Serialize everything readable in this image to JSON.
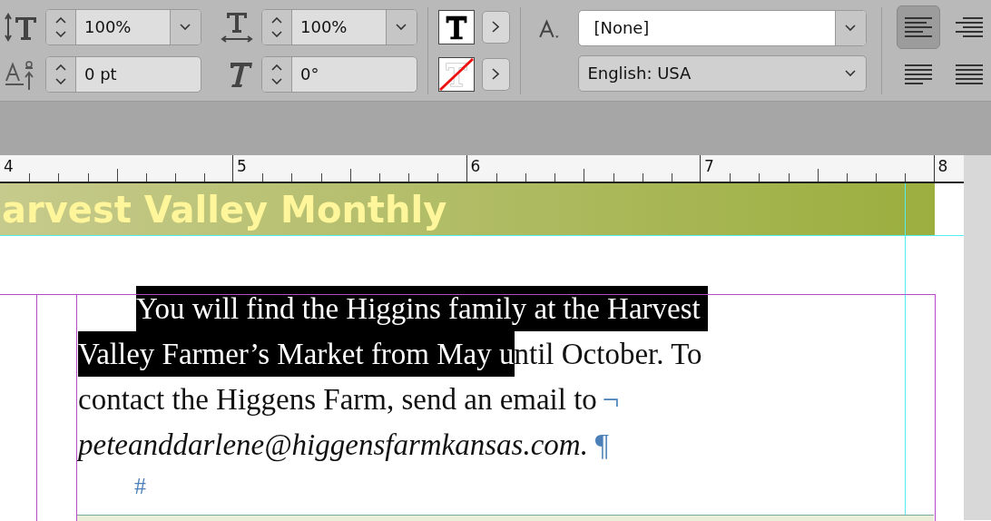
{
  "toolbar": {
    "vertical_scale": {
      "value": "100%"
    },
    "horizontal_scale": {
      "value": "100%"
    },
    "baseline_shift": {
      "value": "0 pt"
    },
    "skew": {
      "value": "0°"
    },
    "character_style": {
      "value": "[None]"
    },
    "language": {
      "value": "English: USA"
    },
    "align_buttons": [
      {
        "selected": true
      },
      {
        "selected": false
      },
      {
        "selected": false
      },
      {
        "selected": false
      }
    ]
  },
  "ruler": {
    "labels": [
      "4",
      "5",
      "6",
      "7",
      "8"
    ]
  },
  "banner": {
    "text": "arvest Valley Monthly"
  },
  "body": {
    "lines": [
      {
        "indent": true,
        "segments": [
          {
            "text": "You will find the Higgins family at the Harvest ",
            "selected": true
          }
        ]
      },
      {
        "indent": false,
        "segments": [
          {
            "text": "Valley Farmer’s Market from May u",
            "selected": true
          },
          {
            "text": "ntil October. To",
            "selected": false
          }
        ]
      },
      {
        "indent": false,
        "segments": [
          {
            "text": "contact the Higgens Farm, send an email to",
            "selected": false
          }
        ],
        "mark": "¬"
      },
      {
        "indent": false,
        "italic": true,
        "segments": [
          {
            "text": "peteanddarlene@higgensfarmkansas.com.",
            "selected": false
          }
        ],
        "mark": "¶"
      }
    ],
    "end_mark": "#"
  }
}
